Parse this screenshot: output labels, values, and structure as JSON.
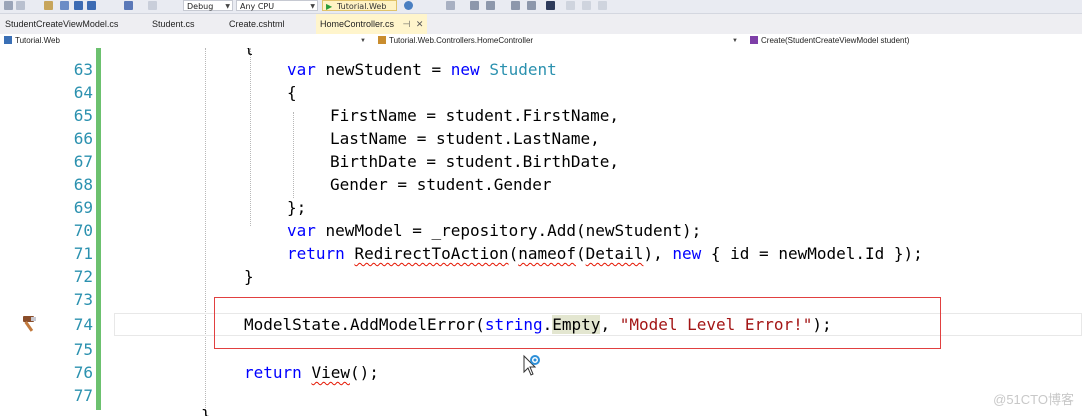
{
  "toolbar": {
    "config": "Debug",
    "platform": "Any CPU",
    "start_project": "Tutorial.Web"
  },
  "tabs": [
    {
      "label": "StudentCreateViewModel.cs"
    },
    {
      "label": "Student.cs"
    },
    {
      "label": "Create.cshtml"
    },
    {
      "label": "HomeController.cs",
      "active": true
    }
  ],
  "navbar": {
    "project": "Tutorial.Web",
    "class": "Tutorial.Web.Controllers.HomeController",
    "member": "Create(StudentCreateViewModel student)"
  },
  "code": {
    "line_numbers": [
      "63",
      "64",
      "65",
      "66",
      "67",
      "68",
      "69",
      "70",
      "71",
      "72",
      "73",
      "74",
      "75",
      "76",
      "77"
    ]
  },
  "watermark": "@51CTO博客",
  "colors": {
    "keyword": "#0000ff",
    "type": "#2b91af",
    "string": "#a31515",
    "changebar": "#6cc16f",
    "highlight_box": "#e14040"
  }
}
